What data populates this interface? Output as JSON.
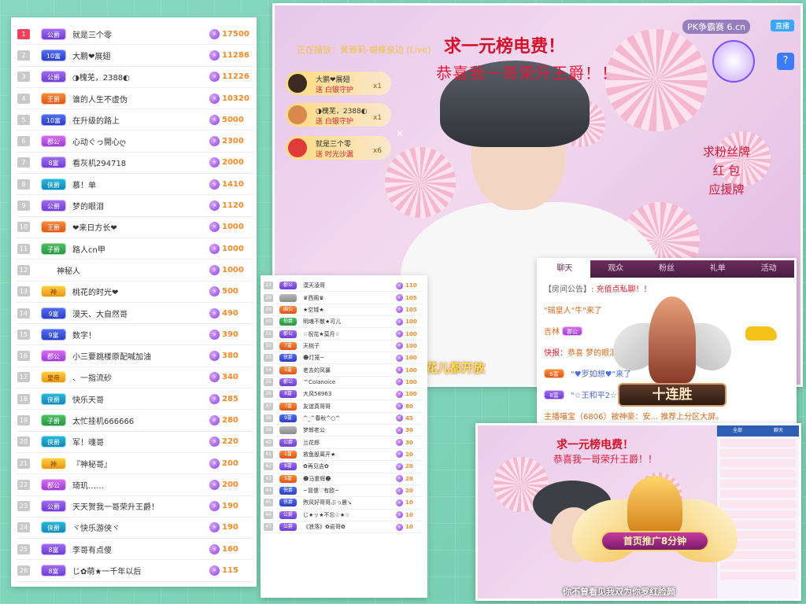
{
  "left_ranking": [
    {
      "rank": "1",
      "badge": "公爵",
      "name": "就是三个零",
      "value": "17500",
      "style": "b1"
    },
    {
      "rank": "2",
      "badge": "10富",
      "name": "大鹏❤展翅",
      "value": "11286",
      "style": "b2"
    },
    {
      "rank": "3",
      "badge": "公爵",
      "name": "◑槐芜，2388◐",
      "value": "11226",
      "style": "b1"
    },
    {
      "rank": "4",
      "badge": "王爵",
      "name": "谁的人生不虚伪",
      "value": "10320",
      "style": "b3"
    },
    {
      "rank": "5",
      "badge": "10富",
      "name": "在升级的路上",
      "value": "5000",
      "style": "b2"
    },
    {
      "rank": "6",
      "badge": "郡公",
      "name": "心动ぐっ開心ღ",
      "value": "2300",
      "style": "b8"
    },
    {
      "rank": "7",
      "badge": "8富",
      "name": "看灰机294718",
      "value": "2000",
      "style": "b1"
    },
    {
      "rank": "8",
      "badge": "侠爵",
      "name": "慕！单",
      "value": "1410",
      "style": "b4"
    },
    {
      "rank": "9",
      "badge": "公爵",
      "name": "梦的眼泪",
      "value": "1120",
      "style": "b1"
    },
    {
      "rank": "10",
      "badge": "王爵",
      "name": "❤来日方长❤",
      "value": "1000",
      "style": "b3"
    },
    {
      "rank": "11",
      "badge": "子爵",
      "name": "路人cn甲",
      "value": "1000",
      "style": "b5"
    },
    {
      "rank": "12",
      "badge": "",
      "name": "神秘人",
      "value": "1000",
      "style": "hidden"
    },
    {
      "rank": "13",
      "badge": "神",
      "name": "桃花的时光❤",
      "value": "500",
      "style": "b7"
    },
    {
      "rank": "14",
      "badge": "9富",
      "name": "漠天、大自然哥",
      "value": "490",
      "style": "b2"
    },
    {
      "rank": "15",
      "badge": "9富",
      "name": "数字！",
      "value": "390",
      "style": "b2"
    },
    {
      "rank": "16",
      "badge": "郡公",
      "name": "小三要跳楼原配喊加油",
      "value": "380",
      "style": "b8"
    },
    {
      "rank": "17",
      "badge": "皇帝",
      "name": "、一指流砂",
      "value": "340",
      "style": "b7"
    },
    {
      "rank": "18",
      "badge": "侠爵",
      "name": "快乐天哥",
      "value": "285",
      "style": "b4"
    },
    {
      "rank": "19",
      "badge": "子爵",
      "name": "太忙挂机666666",
      "value": "280",
      "style": "b5"
    },
    {
      "rank": "20",
      "badge": "侠爵",
      "name": "军！魂哥",
      "value": "220",
      "style": "b4"
    },
    {
      "rank": "21",
      "badge": "神",
      "name": "『神秘哥』",
      "value": "200",
      "style": "b7"
    },
    {
      "rank": "22",
      "badge": "郡公",
      "name": "琦玑……",
      "value": "200",
      "style": "b8"
    },
    {
      "rank": "23",
      "badge": "公爵",
      "name": "天天贺我一哥荣升王爵！",
      "value": "190",
      "style": "b1"
    },
    {
      "rank": "24",
      "badge": "侠爵",
      "name": "ヾ快乐游侠ヾ",
      "value": "190",
      "style": "b4"
    },
    {
      "rank": "25",
      "badge": "8富",
      "name": "李哥有点傻",
      "value": "160",
      "style": "b1"
    },
    {
      "rank": "26",
      "badge": "8富",
      "name": "じ✿萌★一千年以后",
      "value": "115",
      "style": "b1"
    }
  ],
  "mid_ranking": [
    {
      "rank": "27",
      "badge": "郡公",
      "name": "漠天凌哥",
      "value": "110",
      "style": "b1"
    },
    {
      "rank": "28",
      "badge": "",
      "name": "♛西阁♛",
      "value": "105",
      "style": "b6"
    },
    {
      "rank": "29",
      "badge": "国公",
      "name": "★空城★",
      "value": "105",
      "style": "b3"
    },
    {
      "rank": "30",
      "badge": "伯爵",
      "name": "明魂不散★可儿",
      "value": "100",
      "style": "b5"
    },
    {
      "rank": "31",
      "badge": "郡公",
      "name": "☆祝花★莫月☆",
      "value": "100",
      "style": "b1"
    },
    {
      "rank": "32",
      "badge": "7富",
      "name": "天桃子",
      "value": "100",
      "style": "b3"
    },
    {
      "rank": "33",
      "badge": "侠爵",
      "name": "☻灯笼~",
      "value": "100",
      "style": "b2"
    },
    {
      "rank": "34",
      "badge": "5富",
      "name": "老去的风暴",
      "value": "100",
      "style": "b3"
    },
    {
      "rank": "35",
      "badge": "郡公",
      "name": "™Colanoice",
      "value": "100",
      "style": "b1"
    },
    {
      "rank": "36",
      "badge": "8富",
      "name": "大风58963",
      "value": "100",
      "style": "b1"
    },
    {
      "rank": "37",
      "badge": "7富",
      "name": "友谊真哥哥",
      "value": "80",
      "style": "b3"
    },
    {
      "rank": "38",
      "badge": "9富",
      "name": "^_^春秋^○^",
      "value": "45",
      "style": "b2"
    },
    {
      "rank": "39",
      "badge": "",
      "name": "梦郎老公",
      "value": "30",
      "style": "b6"
    },
    {
      "rank": "40",
      "badge": "公爵",
      "name": "兰花郎",
      "value": "30",
      "style": "b1"
    },
    {
      "rank": "41",
      "badge": "1富",
      "name": "救鱼股离开★",
      "value": "20",
      "style": "b3"
    },
    {
      "rank": "42",
      "badge": "8富",
      "name": "✿再见吉✿",
      "value": "20",
      "style": "b1"
    },
    {
      "rank": "43",
      "badge": "5富",
      "name": "☻马重辉☻",
      "value": "20",
      "style": "b3"
    },
    {
      "rank": "44",
      "badge": "侠爵",
      "name": "~冒儒♡有欧~",
      "value": "20",
      "style": "b2"
    },
    {
      "rank": "45",
      "badge": "侠爵",
      "name": "煦风好哥哥ぶっ晨↘",
      "value": "10",
      "style": "b2"
    },
    {
      "rank": "46",
      "badge": "公爵",
      "name": "じ★ッ★不忘☆★☆",
      "value": "10",
      "style": "b1"
    },
    {
      "rank": "47",
      "badge": "公爵",
      "name": "《浪落》✿岩哥✿",
      "value": "10",
      "style": "b1"
    }
  ],
  "stream": {
    "title": "求一元榜电费！",
    "subtitle": "恭喜我一哥荣升王爵！！",
    "now_playing": "正在播放：黄雅莉-蝴蝶泉边 (Live)",
    "pk_label": "PK争霸赛",
    "site": "6.cn",
    "live_label": "直播",
    "side_note_1": "求粉丝牌",
    "side_note_2": "红  包",
    "side_note_3": "应援牌",
    "bottom_caption": "花儿都开放",
    "help": "?",
    "close": "✕"
  },
  "gifts": [
    {
      "name": "大鹏❤展翅",
      "send": "送 白银守护",
      "count": "x1"
    },
    {
      "name": "◑槐芜，2388◐",
      "send": "送 白银守护",
      "count": "x1"
    },
    {
      "name": "就是三个零",
      "send": "送 时光沙漏",
      "count": "x6"
    }
  ],
  "chat": {
    "tabs": [
      "聊天",
      "观众",
      "粉丝",
      "礼单",
      "活动"
    ],
    "notice_label": "【房间公告】:",
    "notice_text": "充值点私聊！！",
    "line2": "\"瑞皇人\"牛\"来了",
    "line3_user": "吉林",
    "line3_badge": "郡公",
    "line4_label": "快报：",
    "line4_text": "恭喜 梦的眼泪",
    "line5_badge": "6富",
    "line5_text": "\"♥罗如想♥\"来了",
    "line6_badge": "8富",
    "line6_text": "\"☆王和平2☆\"来了",
    "line7": "主播喵宝（6806）被神豪：安... 推荐上分区大屏。",
    "emblem_text": "十连胜"
  },
  "small_stream": {
    "title": "求一元榜电费！",
    "subtitle": "恭喜我一哥荣升王爵！！",
    "banner_text": "首页推广8分钟",
    "bottom_caption": "你不曾看见我双为你罗红脸颜",
    "side_tabs": [
      "全部",
      "聊天"
    ]
  }
}
